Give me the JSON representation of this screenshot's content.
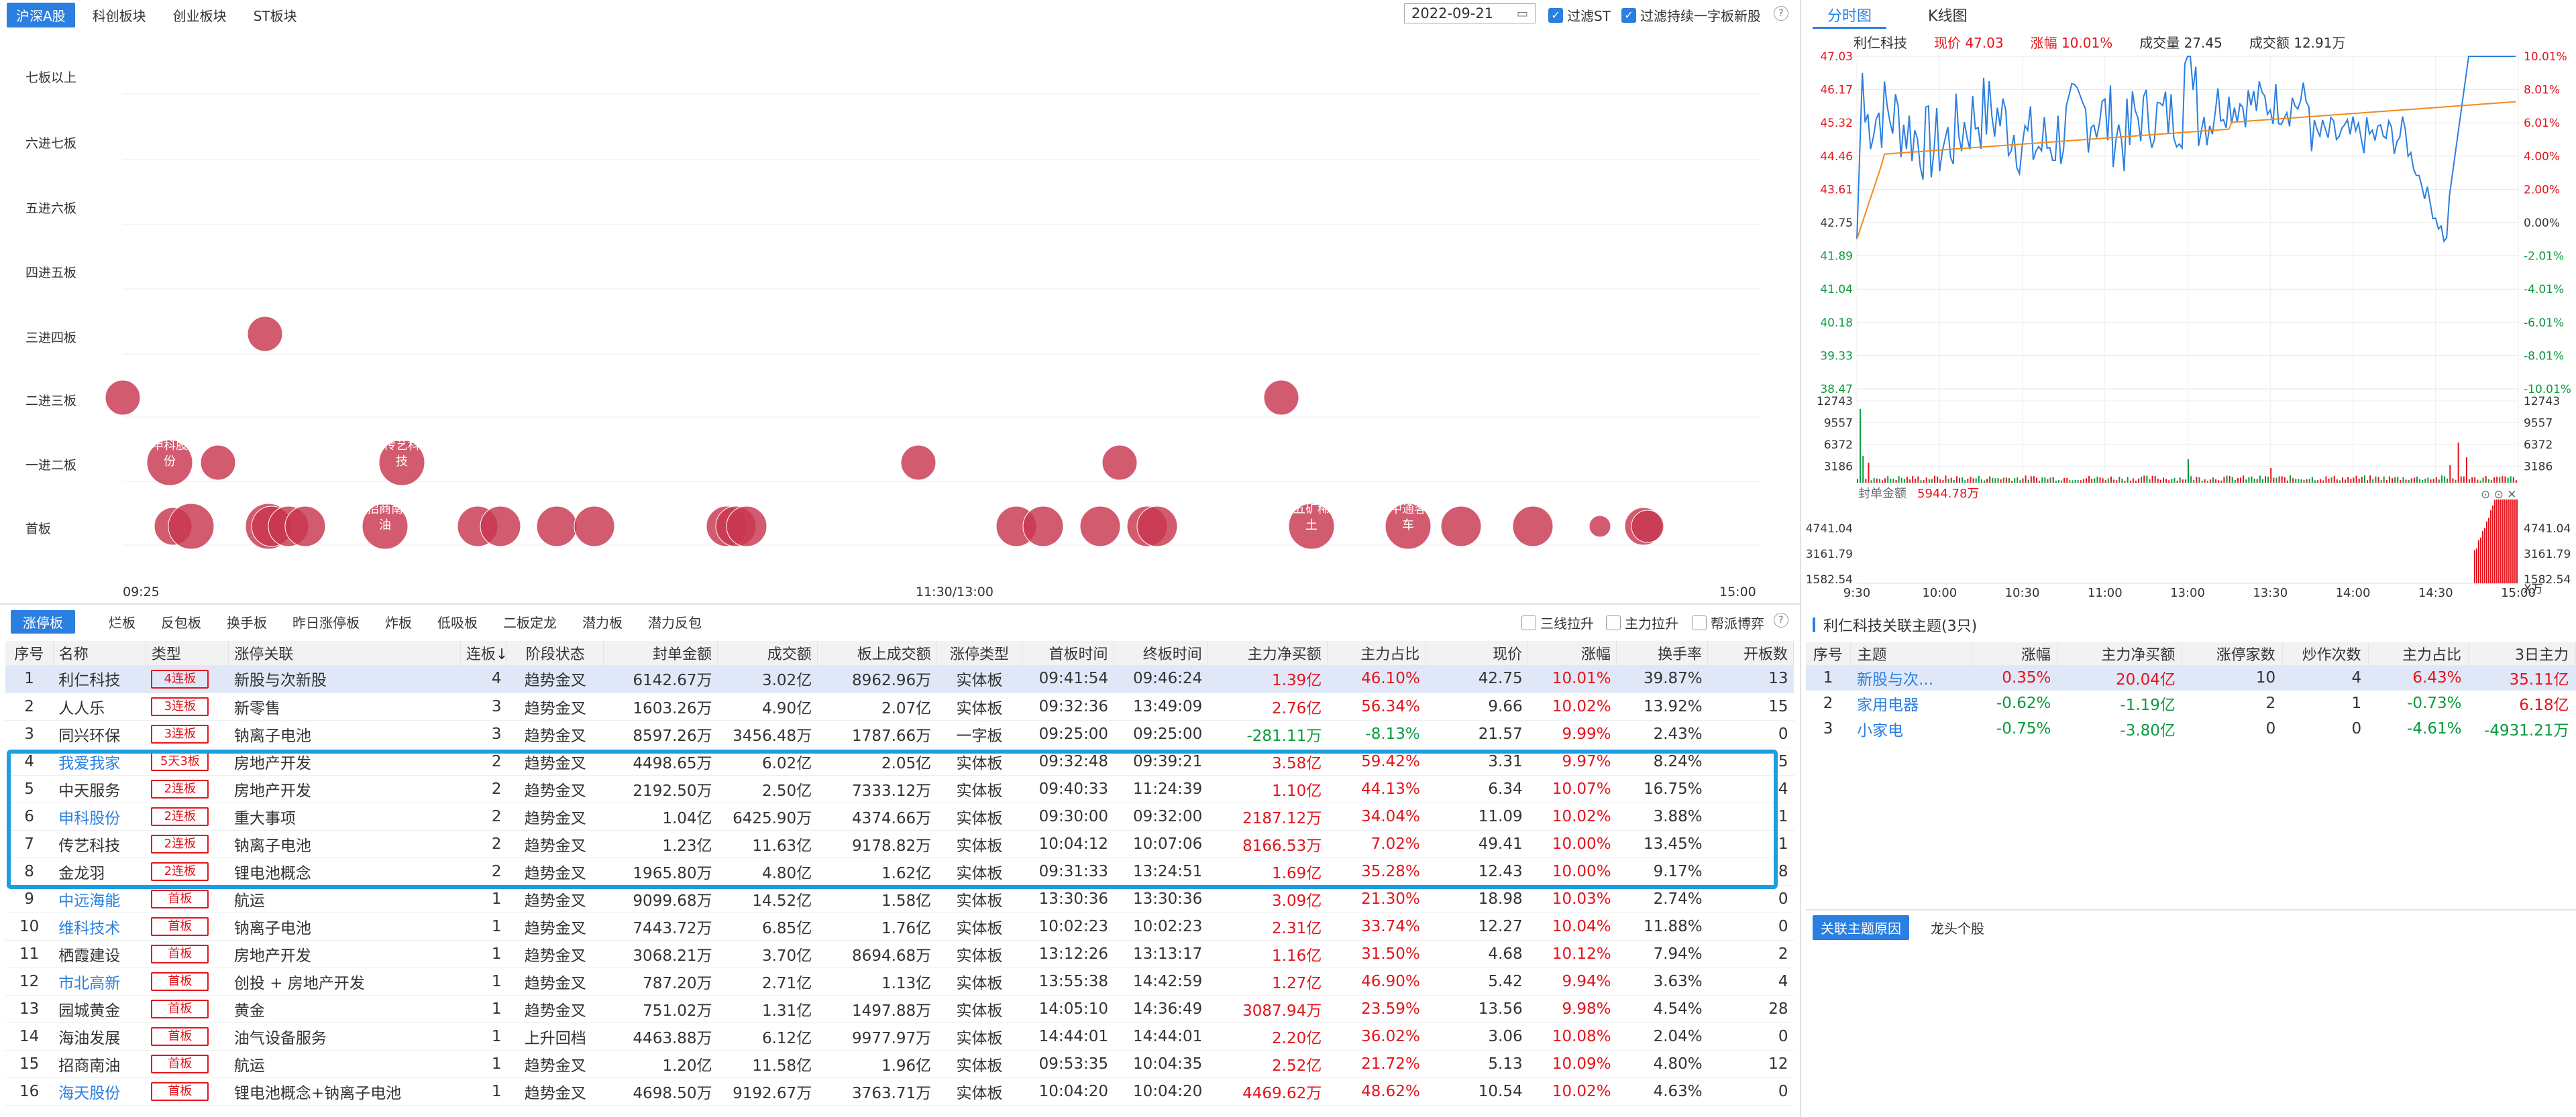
{
  "top_tabs": [
    "沪深A股",
    "科创板块",
    "创业板块",
    "ST板块"
  ],
  "date": "2022-09-21",
  "checks": [
    "过滤ST",
    "过滤持续一字板新股"
  ],
  "ladder": {
    "rows": [
      "七板以上",
      "六进七板",
      "五进六板",
      "四进五板",
      "三进四板",
      "二进三板",
      "一进二板",
      "首板"
    ],
    "time_labels": [
      "09:25",
      "11:30/13:00",
      "15:00"
    ],
    "bubble_labels": [
      "申科股份",
      "传艺科技",
      "招商南油",
      "五矿稀土",
      "中通客车"
    ]
  },
  "right_tabs": [
    "分时图",
    "K线图"
  ],
  "quote": {
    "name": "利仁科技",
    "price_label": "现价",
    "price": "47.03",
    "pct_label": "涨幅",
    "pct": "10.01%",
    "vol_label": "成交量",
    "vol": "27.45",
    "amt_label": "成交额",
    "amt": "12.91万"
  },
  "minute_chart": {
    "price_ticks": [
      "47.03",
      "46.17",
      "45.32",
      "44.46",
      "43.61",
      "42.75",
      "41.89",
      "41.04",
      "40.18",
      "39.33",
      "38.47"
    ],
    "pct_ticks": [
      "10.01%",
      "8.01%",
      "6.01%",
      "4.00%",
      "2.00%",
      "0.00%",
      "-2.01%",
      "-4.01%",
      "-6.01%",
      "-8.01%",
      "-10.01%"
    ],
    "vol_ticks": [
      "12743",
      "9557",
      "6372",
      "3186"
    ],
    "seal_label": "封单金额",
    "seal_value": "5944.78万",
    "seal_ticks": [
      "4741.04",
      "3161.79",
      "1582.54"
    ],
    "seal_unit": "X万",
    "time_ticks": [
      "9:30",
      "10:00",
      "10:30",
      "11:00",
      "13:00",
      "13:30",
      "14:00",
      "14:30",
      "15:00"
    ]
  },
  "filter_tabs": [
    "涨停板",
    "烂板",
    "反包板",
    "换手板",
    "昨日涨停板",
    "炸板",
    "低吸板",
    "二板定龙",
    "潜力板",
    "潜力反包"
  ],
  "filter_checks": [
    "三线拉升",
    "主力拉升",
    "帮派博弈"
  ],
  "table": {
    "headers": [
      "序号",
      "名称",
      "类型",
      "涨停关联",
      "连板↓",
      "阶段状态",
      "封单金额",
      "成交额",
      "板上成交额",
      "涨停类型",
      "首板时间",
      "终板时间",
      "主力净买额",
      "主力占比",
      "现价",
      "涨幅",
      "换手率",
      "开板数"
    ],
    "rows": [
      [
        "1",
        "利仁科技",
        "4连板",
        "新股与次新股",
        "4",
        "趋势金叉",
        "6142.67万",
        "3.02亿",
        "8962.96万",
        "实体板",
        "09:41:54",
        "09:46:24",
        "1.39亿",
        "46.10%",
        "42.75",
        "10.01%",
        "39.87%",
        "13"
      ],
      [
        "2",
        "人人乐",
        "3连板",
        "新零售",
        "3",
        "趋势金叉",
        "1603.26万",
        "4.90亿",
        "2.07亿",
        "实体板",
        "09:32:36",
        "13:49:09",
        "2.76亿",
        "56.34%",
        "9.66",
        "10.02%",
        "13.92%",
        "15"
      ],
      [
        "3",
        "同兴环保",
        "3连板",
        "钠离子电池",
        "3",
        "趋势金叉",
        "8597.26万",
        "3456.48万",
        "1787.66万",
        "一字板",
        "09:25:00",
        "09:25:00",
        "-281.11万",
        "-8.13%",
        "21.57",
        "9.99%",
        "2.43%",
        "0"
      ],
      [
        "4",
        "我爱我家",
        "5天3板",
        "房地产开发",
        "2",
        "趋势金叉",
        "4498.65万",
        "6.02亿",
        "2.05亿",
        "实体板",
        "09:32:48",
        "09:39:21",
        "3.58亿",
        "59.42%",
        "3.31",
        "9.97%",
        "8.24%",
        "5"
      ],
      [
        "5",
        "中天服务",
        "2连板",
        "房地产开发",
        "2",
        "趋势金叉",
        "2192.50万",
        "2.50亿",
        "7333.12万",
        "实体板",
        "09:40:33",
        "11:24:39",
        "1.10亿",
        "44.13%",
        "6.34",
        "10.07%",
        "16.75%",
        "4"
      ],
      [
        "6",
        "申科股份",
        "2连板",
        "重大事项",
        "2",
        "趋势金叉",
        "1.04亿",
        "6425.90万",
        "4374.66万",
        "实体板",
        "09:30:00",
        "09:32:00",
        "2187.12万",
        "34.04%",
        "11.09",
        "10.02%",
        "3.88%",
        "1"
      ],
      [
        "7",
        "传艺科技",
        "2连板",
        "钠离子电池",
        "2",
        "趋势金叉",
        "1.23亿",
        "11.63亿",
        "9178.82万",
        "实体板",
        "10:04:12",
        "10:07:06",
        "8166.53万",
        "7.02%",
        "49.41",
        "10.00%",
        "13.45%",
        "1"
      ],
      [
        "8",
        "金龙羽",
        "2连板",
        "锂电池概念",
        "2",
        "趋势金叉",
        "1965.80万",
        "4.80亿",
        "1.62亿",
        "实体板",
        "09:31:33",
        "13:24:51",
        "1.69亿",
        "35.28%",
        "12.43",
        "10.00%",
        "9.17%",
        "8"
      ],
      [
        "9",
        "中远海能",
        "首板",
        "航运",
        "1",
        "趋势金叉",
        "9099.68万",
        "14.52亿",
        "1.58亿",
        "实体板",
        "13:30:36",
        "13:30:36",
        "3.09亿",
        "21.30%",
        "18.98",
        "10.03%",
        "2.74%",
        "0"
      ],
      [
        "10",
        "维科技术",
        "首板",
        "钠离子电池",
        "1",
        "趋势金叉",
        "7443.72万",
        "6.85亿",
        "1.76亿",
        "实体板",
        "10:02:23",
        "10:02:23",
        "2.31亿",
        "33.74%",
        "12.27",
        "10.04%",
        "11.88%",
        "0"
      ],
      [
        "11",
        "栖霞建设",
        "首板",
        "房地产开发",
        "1",
        "趋势金叉",
        "3068.21万",
        "3.70亿",
        "8694.68万",
        "实体板",
        "13:12:26",
        "13:13:17",
        "1.16亿",
        "31.50%",
        "4.68",
        "10.12%",
        "7.94%",
        "2"
      ],
      [
        "12",
        "市北高新",
        "首板",
        "创投 + 房地产开发",
        "1",
        "趋势金叉",
        "787.20万",
        "2.71亿",
        "1.13亿",
        "实体板",
        "13:55:38",
        "14:42:59",
        "1.27亿",
        "46.90%",
        "5.42",
        "9.94%",
        "3.63%",
        "4"
      ],
      [
        "13",
        "园城黄金",
        "首板",
        "黄金",
        "1",
        "趋势金叉",
        "751.02万",
        "1.31亿",
        "1497.88万",
        "实体板",
        "14:05:10",
        "14:36:49",
        "3087.94万",
        "23.59%",
        "13.56",
        "9.98%",
        "4.54%",
        "28"
      ],
      [
        "14",
        "海油发展",
        "首板",
        "油气设备服务",
        "1",
        "上升回档",
        "4463.88万",
        "6.12亿",
        "9977.97万",
        "实体板",
        "14:44:01",
        "14:44:01",
        "2.20亿",
        "36.02%",
        "3.06",
        "10.08%",
        "2.04%",
        "0"
      ],
      [
        "15",
        "招商南油",
        "首板",
        "航运",
        "1",
        "趋势金叉",
        "1.20亿",
        "11.58亿",
        "1.96亿",
        "实体板",
        "09:53:35",
        "10:04:35",
        "2.52亿",
        "21.72%",
        "5.13",
        "10.09%",
        "4.80%",
        "12"
      ],
      [
        "16",
        "海天股份",
        "首板",
        "锂电池概念+钠离子电池",
        "1",
        "趋势金叉",
        "4698.50万",
        "9192.67万",
        "3763.71万",
        "实体板",
        "10:04:20",
        "10:04:20",
        "4469.62万",
        "48.62%",
        "10.54",
        "10.02%",
        "4.63%",
        "0"
      ]
    ],
    "blue_names": [
      "我爱我家",
      "申科股份",
      "中远海能",
      "维科技术",
      "市北高新",
      "海天股份"
    ]
  },
  "related": {
    "title": "利仁科技关联主题(3只)",
    "headers": [
      "序号",
      "主题",
      "涨幅",
      "主力净买额",
      "涨停家数",
      "炒作次数",
      "主力占比",
      "3日主力"
    ],
    "rows": [
      [
        "1",
        "新股与次...",
        "0.35%",
        "20.04亿",
        "10",
        "4",
        "6.43%",
        "35.11亿"
      ],
      [
        "2",
        "家用电器",
        "-0.62%",
        "-1.19亿",
        "2",
        "1",
        "-0.73%",
        "6.18亿"
      ],
      [
        "3",
        "小家电",
        "-0.75%",
        "-3.80亿",
        "0",
        "0",
        "-4.61%",
        "-4931.21万"
      ]
    ]
  },
  "bottom_tabs": [
    "关联主题原因",
    "龙头个股"
  ],
  "colors": {
    "accent": "#2a7fe0",
    "up": "#e4141c",
    "down": "#0a9a3c",
    "bubble": "#c8374f",
    "highlight": "#1a9ee0"
  }
}
